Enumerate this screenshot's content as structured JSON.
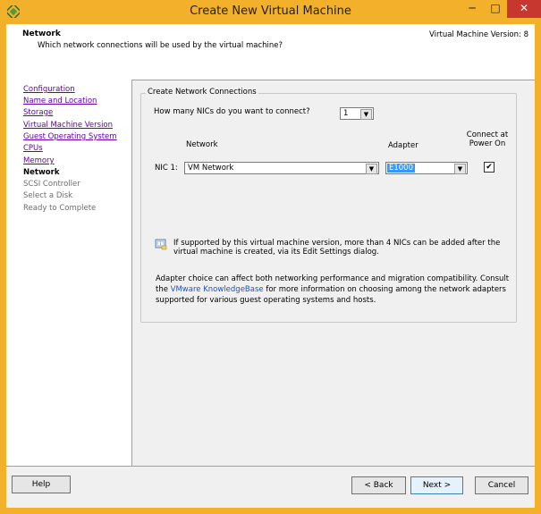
{
  "window": {
    "title": "Create New Virtual Machine",
    "minimize": "─",
    "maximize": "□",
    "close": "✕"
  },
  "header": {
    "title": "Network",
    "subtitle": "Which network connections will be used by the virtual machine?",
    "version": "Virtual Machine Version: 8"
  },
  "nav": {
    "items": [
      {
        "label": "Configuration",
        "state": "link"
      },
      {
        "label": "Name and Location",
        "state": "link"
      },
      {
        "label": "Storage",
        "state": "link"
      },
      {
        "label": "Virtual Machine Version",
        "state": "link"
      },
      {
        "label": "Guest Operating System",
        "state": "link"
      },
      {
        "label": "CPUs",
        "state": "link"
      },
      {
        "label": "Memory",
        "state": "link"
      },
      {
        "label": "Network",
        "state": "current"
      },
      {
        "label": "SCSI Controller",
        "state": "pending"
      },
      {
        "label": "Select a Disk",
        "state": "pending"
      },
      {
        "label": "Ready to Complete",
        "state": "pending"
      }
    ]
  },
  "group": {
    "legend": "Create Network Connections",
    "nic_question": "How many NICs do you want to connect?",
    "nic_count": "1",
    "col_network": "Network",
    "col_adapter": "Adapter",
    "col_connect_1": "Connect at",
    "col_connect_2": "Power On",
    "nic_label": "NIC 1:",
    "network_value": "VM Network",
    "adapter_value": "E1000",
    "connect_checked": "✔",
    "info_line1": "If supported by this virtual machine version, more than 4 NICs can be added after the",
    "info_line2": "virtual machine is created, via its Edit Settings dialog.",
    "note_line1": "Adapter choice can affect both networking performance and migration compatibility. Consult",
    "note_line2_pre": "the ",
    "note_link": "VMware KnowledgeBase",
    "note_line2_post": " for more information on choosing among the network adapters",
    "note_line3": "supported for various guest operating systems and hosts."
  },
  "buttons": {
    "help": "Help",
    "back": "< Back",
    "next": "Next >",
    "cancel": "Cancel"
  },
  "colors": {
    "title_bar": "#f3b02a",
    "close_button": "#c7372f",
    "visited_link": "#6600aa",
    "link": "#1e4fd8",
    "selection": "#3399ff"
  }
}
